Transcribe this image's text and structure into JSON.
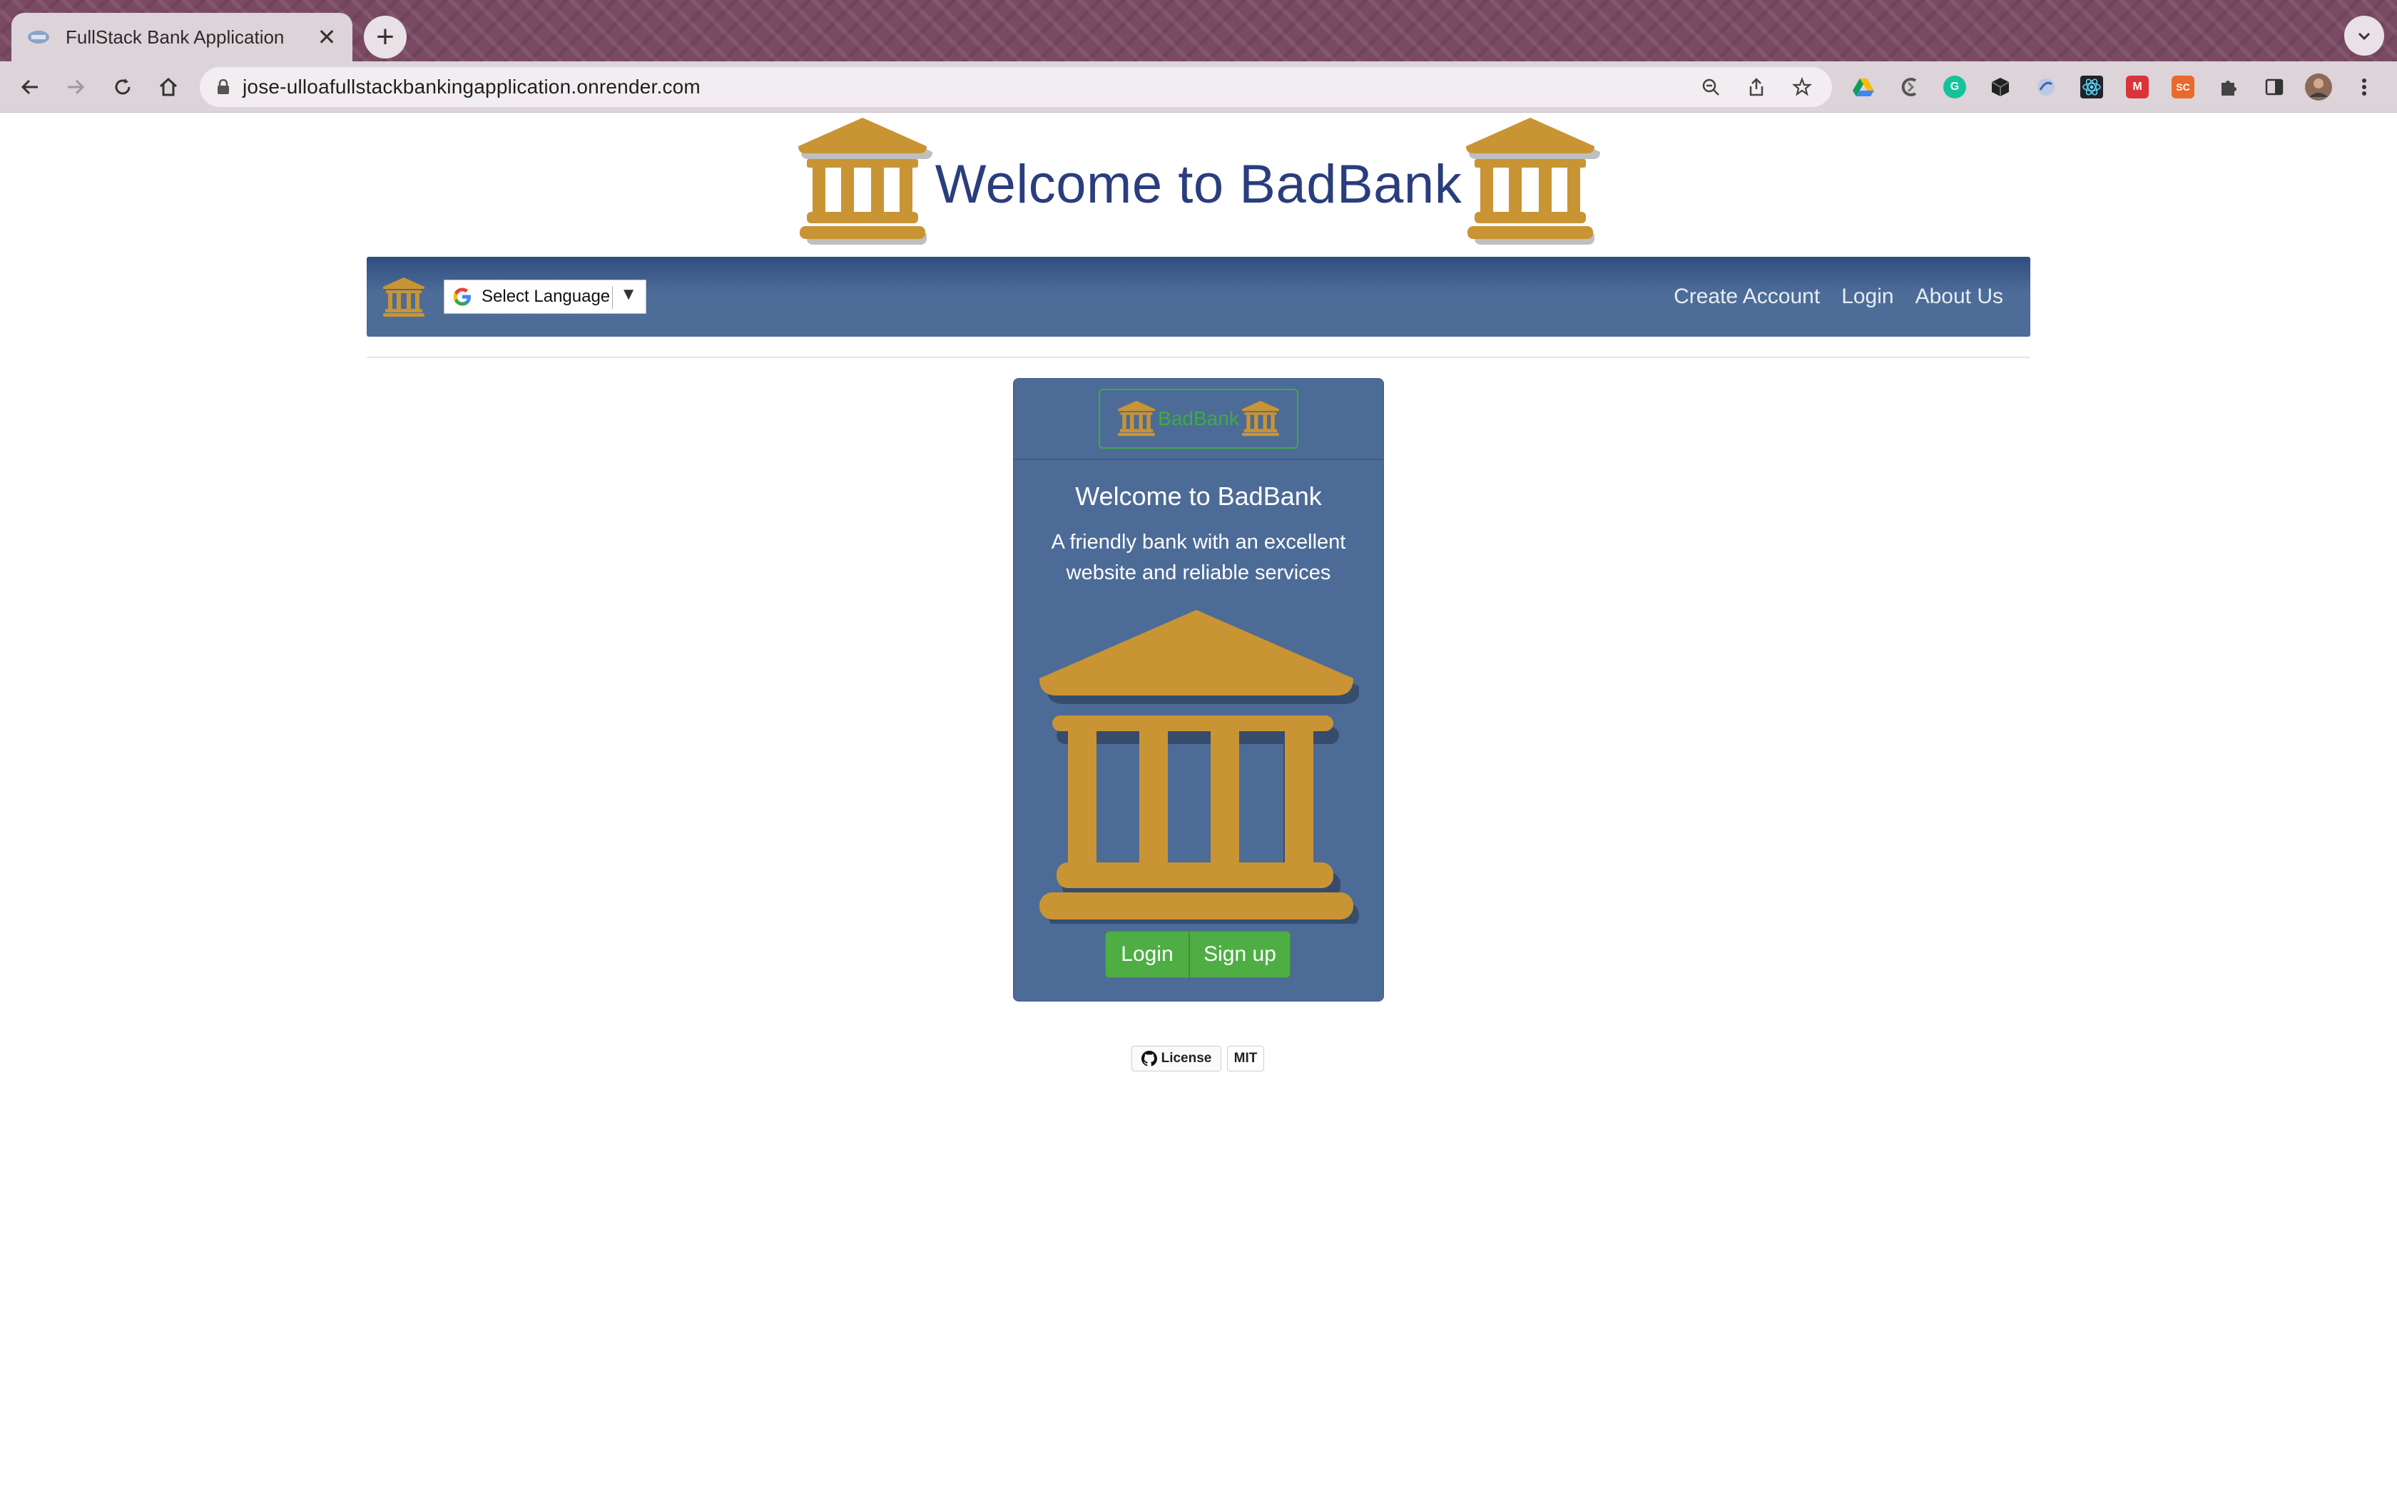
{
  "browser": {
    "tab_title": "FullStack Bank Application",
    "tab_close": "✕",
    "new_tab": "+",
    "url": "jose-ulloafullstackbankingapplication.onrender.com",
    "extensions": [
      "google-drive-icon",
      "cursive-icon",
      "grammarly-icon",
      "cube-icon",
      "circle-ext-icon",
      "react-devtools-icon",
      "ms-icon",
      "sc-icon",
      "puzzle-icon",
      "sidepanel-icon",
      "profile-avatar",
      "menu-icon"
    ],
    "ext_labels": {
      "ms": "M",
      "sc": "SC"
    }
  },
  "header": {
    "title": "Welcome to BadBank"
  },
  "navbar": {
    "language_select": "Select Language",
    "language_arrow": "▼",
    "links": [
      "Create Account",
      "Login",
      "About Us"
    ]
  },
  "card": {
    "brand": "BadBank",
    "title": "Welcome to BadBank",
    "text": "A friendly bank with an excellent website and reliable services",
    "login_button": "Login",
    "signup_button": "Sign up"
  },
  "footer": {
    "license_label": "License",
    "license_value": "MIT"
  },
  "colors": {
    "accent_gold": "#c99434",
    "navbar_blue": "#4d6b97",
    "title_blue": "#2a3d7d",
    "button_green": "#4eae44"
  }
}
